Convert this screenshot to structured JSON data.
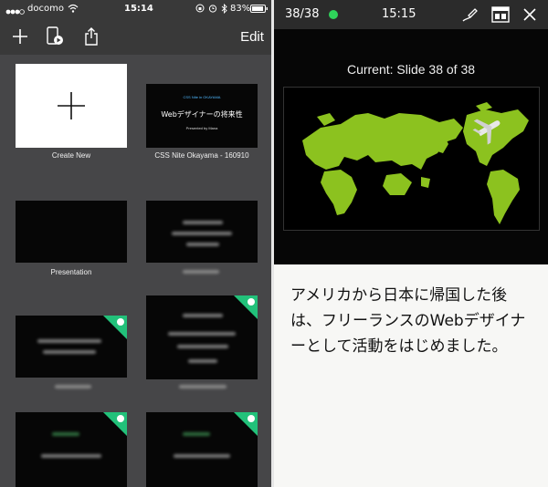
{
  "status_bar": {
    "carrier": "docomo",
    "time": "15:14",
    "battery": "83%"
  },
  "toolbar": {
    "edit_label": "Edit"
  },
  "gallery": {
    "create_new": "Create New",
    "items": [
      {
        "caption": "CSS Nite Okayama - 160910"
      },
      {
        "caption": "Presentation"
      }
    ],
    "featured_slide": {
      "top_text": "CSS Nite in OKAYAMA",
      "title": "Webデザイナーの将来性",
      "byline": "Presented by Mana"
    }
  },
  "presenter": {
    "counter": "38/38",
    "time": "15:15",
    "current_label": "Current: Slide 38 of 38",
    "notes": "アメリカから日本に帰国した後は、フリーランスのWebデザイナーとして活動をはじめました。",
    "status_color": "#2fd35a"
  },
  "colors": {
    "accent_green": "#22c17a",
    "map_green": "#8cc21f"
  }
}
